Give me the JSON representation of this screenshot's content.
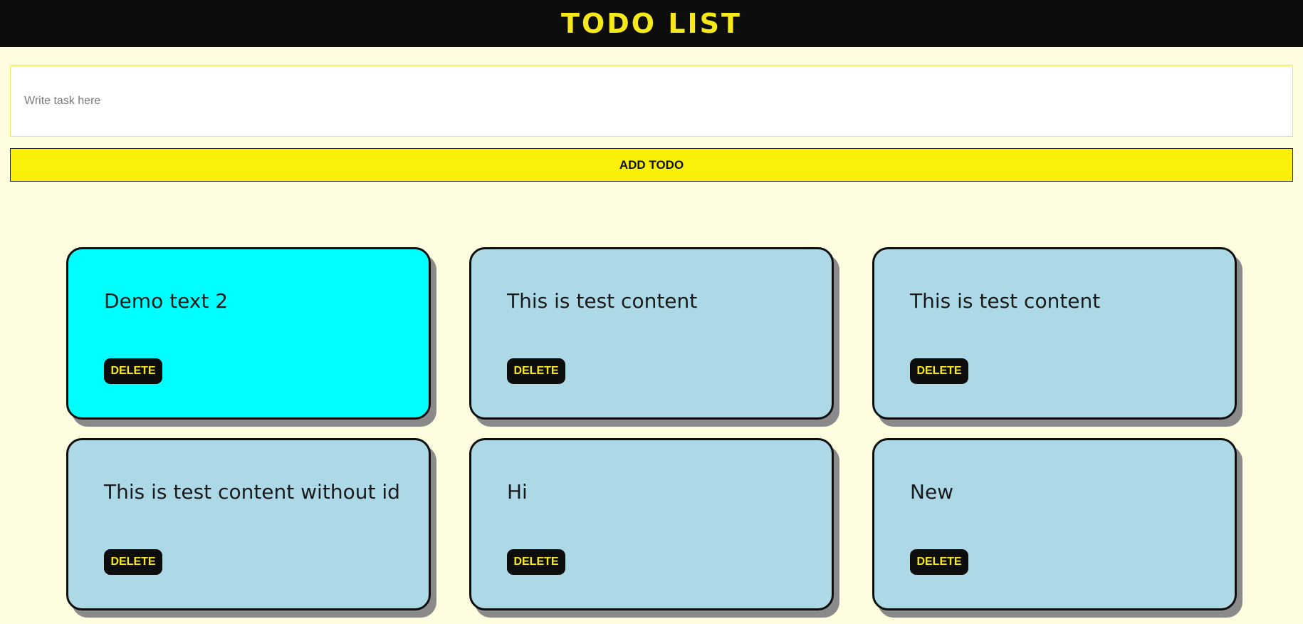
{
  "header": {
    "title": "TODO LIST"
  },
  "form": {
    "input_placeholder": "Write task here",
    "input_value": "",
    "add_label": "ADD TODO"
  },
  "todos": [
    {
      "text": "Demo text 2",
      "delete_label": "DELETE",
      "highlighted": true
    },
    {
      "text": "This is test content",
      "delete_label": "DELETE",
      "highlighted": false
    },
    {
      "text": "This is test content",
      "delete_label": "DELETE",
      "highlighted": false
    },
    {
      "text": "This is test content without id",
      "delete_label": "DELETE",
      "highlighted": false
    },
    {
      "text": "Hi",
      "delete_label": "DELETE",
      "highlighted": false
    },
    {
      "text": "New",
      "delete_label": "DELETE",
      "highlighted": false
    }
  ],
  "colors": {
    "header_bg": "#0d0d0d",
    "accent_yellow": "#f7e81a",
    "button_yellow": "#fbf00a",
    "page_bg": "#fefde0",
    "card_bg": "#add8e6",
    "card_highlight": "#00ffff"
  }
}
